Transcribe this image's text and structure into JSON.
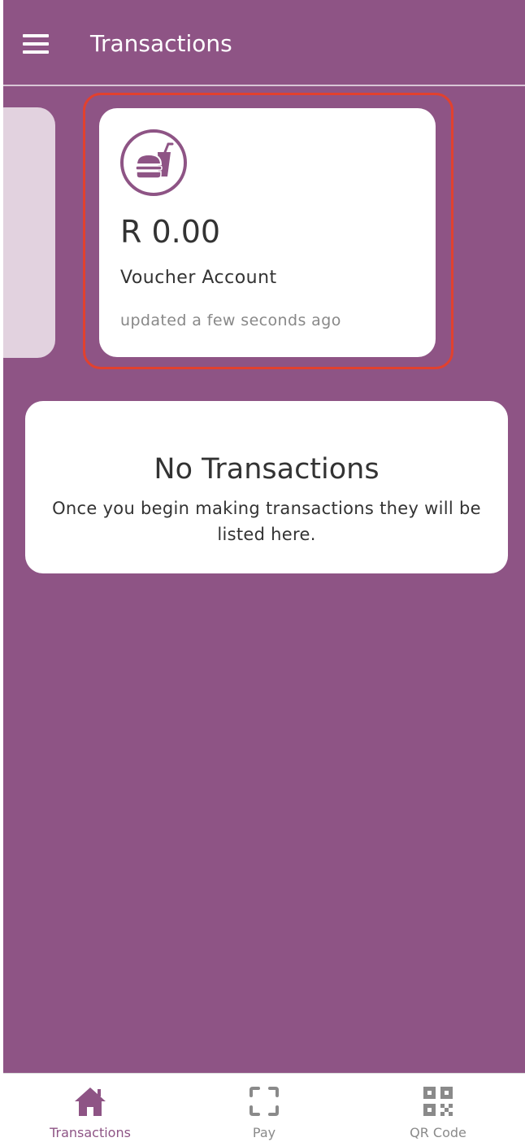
{
  "colors": {
    "primary": "#8e5485",
    "highlight": "#e2412e",
    "card": "#ffffff",
    "inactive": "#8a8a8a"
  },
  "app_bar": {
    "title": "Transactions",
    "menu_icon": "hamburger-menu-icon"
  },
  "account_card": {
    "icon": "fast-food-icon",
    "balance": "R 0.00",
    "name": "Voucher Account",
    "updated": "updated a few seconds ago"
  },
  "empty_state": {
    "title": "No Transactions",
    "message": "Once you begin making transactions they will be listed here."
  },
  "bottom_nav": {
    "items": [
      {
        "label": "Transactions",
        "icon": "home-icon",
        "active": true
      },
      {
        "label": "Pay",
        "icon": "scan-icon",
        "active": false
      },
      {
        "label": "QR Code",
        "icon": "qr-code-icon",
        "active": false
      }
    ]
  }
}
